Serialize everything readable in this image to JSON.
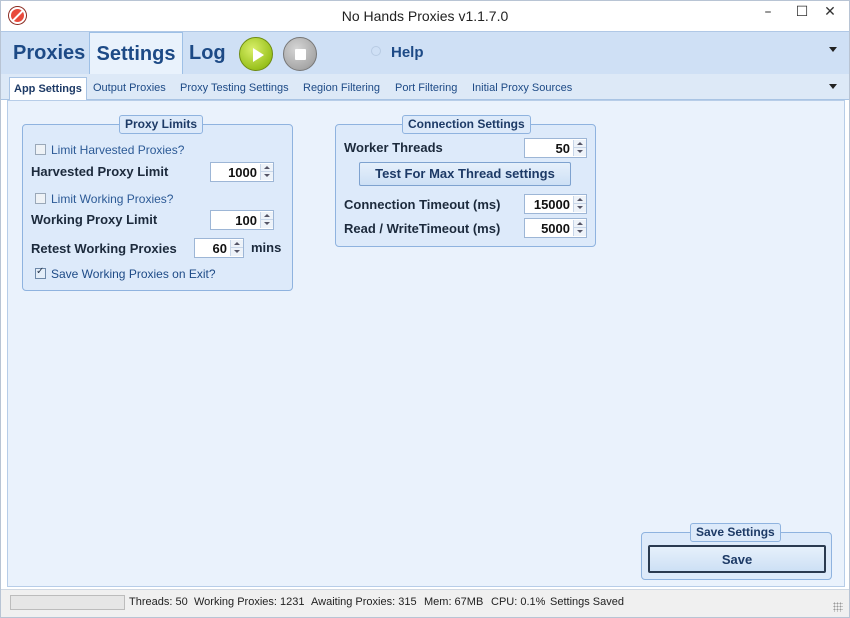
{
  "window": {
    "title": "No Hands Proxies v1.1.7.0",
    "controls": {
      "minimize": "–",
      "maximize": "☐",
      "close": "✕"
    }
  },
  "menu": {
    "items": [
      "Proxies",
      "Settings",
      "Log"
    ],
    "active": "Settings",
    "help_label": "Help",
    "icons": [
      "play-icon",
      "stop-icon",
      "help-icon",
      "chevron-down-icon"
    ]
  },
  "tabs": {
    "items": [
      "App Settings",
      "Output Proxies",
      "Proxy Testing Settings",
      "Region Filtering",
      "Port Filtering",
      "Initial Proxy Sources"
    ],
    "active": "App Settings"
  },
  "proxy_limits": {
    "title": "Proxy Limits",
    "limit_harvested_label": "Limit Harvested Proxies?",
    "limit_harvested_checked": false,
    "harvested_limit_label": "Harvested Proxy Limit",
    "harvested_limit_value": "1000",
    "limit_working_label": "Limit Working Proxies?",
    "limit_working_checked": false,
    "working_limit_label": "Working Proxy Limit",
    "working_limit_value": "100",
    "retest_label": "Retest Working Proxies",
    "retest_value": "60",
    "retest_unit": "mins",
    "save_on_exit_label": "Save Working Proxies on Exit?",
    "save_on_exit_checked": true
  },
  "connection_settings": {
    "title": "Connection Settings",
    "worker_threads_label": "Worker Threads",
    "worker_threads_value": "50",
    "test_button_label": "Test For Max Thread settings",
    "connection_timeout_label": "Connection Timeout (ms)",
    "connection_timeout_value": "15000",
    "rw_timeout_label": "Read / WriteTimeout (ms)",
    "rw_timeout_value": "5000"
  },
  "save_settings": {
    "title": "Save Settings",
    "button_label": "Save"
  },
  "status": {
    "threads": "Threads: 50",
    "working": "Working Proxies: 1231",
    "awaiting": "Awaiting Proxies: 315",
    "mem": "Mem: 67MB",
    "cpu": "CPU: 0.1%",
    "message": "Settings Saved",
    "progress": 0.0
  },
  "colors": {
    "accent": "#1d4a86",
    "menu_bg": "#cfe0f5",
    "panel_bg": "#eaf2fc",
    "group_bg": "#ddeafa",
    "play_green": "#9ac21e"
  }
}
